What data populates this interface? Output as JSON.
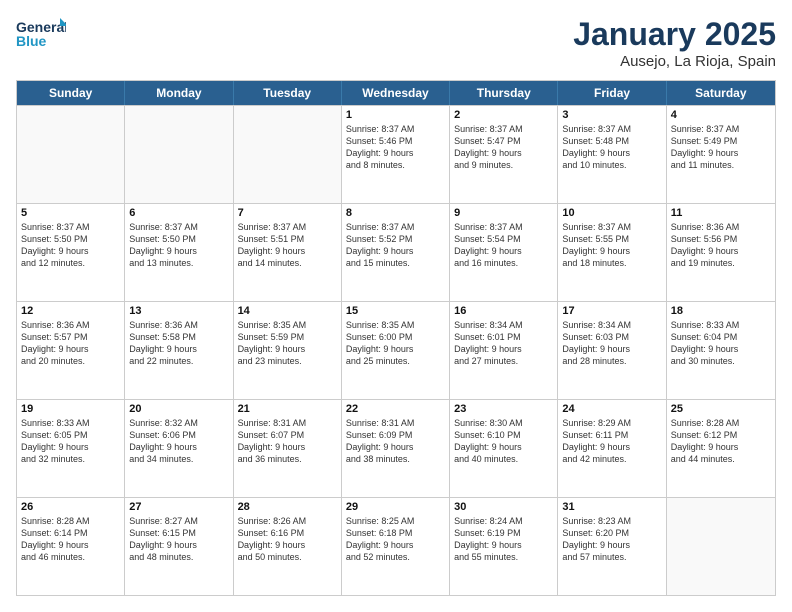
{
  "logo": {
    "line1": "General",
    "line2": "Blue"
  },
  "title": "January 2025",
  "subtitle": "Ausejo, La Rioja, Spain",
  "headers": [
    "Sunday",
    "Monday",
    "Tuesday",
    "Wednesday",
    "Thursday",
    "Friday",
    "Saturday"
  ],
  "rows": [
    [
      {
        "day": "",
        "text": ""
      },
      {
        "day": "",
        "text": ""
      },
      {
        "day": "",
        "text": ""
      },
      {
        "day": "1",
        "text": "Sunrise: 8:37 AM\nSunset: 5:46 PM\nDaylight: 9 hours\nand 8 minutes."
      },
      {
        "day": "2",
        "text": "Sunrise: 8:37 AM\nSunset: 5:47 PM\nDaylight: 9 hours\nand 9 minutes."
      },
      {
        "day": "3",
        "text": "Sunrise: 8:37 AM\nSunset: 5:48 PM\nDaylight: 9 hours\nand 10 minutes."
      },
      {
        "day": "4",
        "text": "Sunrise: 8:37 AM\nSunset: 5:49 PM\nDaylight: 9 hours\nand 11 minutes."
      }
    ],
    [
      {
        "day": "5",
        "text": "Sunrise: 8:37 AM\nSunset: 5:50 PM\nDaylight: 9 hours\nand 12 minutes."
      },
      {
        "day": "6",
        "text": "Sunrise: 8:37 AM\nSunset: 5:50 PM\nDaylight: 9 hours\nand 13 minutes."
      },
      {
        "day": "7",
        "text": "Sunrise: 8:37 AM\nSunset: 5:51 PM\nDaylight: 9 hours\nand 14 minutes."
      },
      {
        "day": "8",
        "text": "Sunrise: 8:37 AM\nSunset: 5:52 PM\nDaylight: 9 hours\nand 15 minutes."
      },
      {
        "day": "9",
        "text": "Sunrise: 8:37 AM\nSunset: 5:54 PM\nDaylight: 9 hours\nand 16 minutes."
      },
      {
        "day": "10",
        "text": "Sunrise: 8:37 AM\nSunset: 5:55 PM\nDaylight: 9 hours\nand 18 minutes."
      },
      {
        "day": "11",
        "text": "Sunrise: 8:36 AM\nSunset: 5:56 PM\nDaylight: 9 hours\nand 19 minutes."
      }
    ],
    [
      {
        "day": "12",
        "text": "Sunrise: 8:36 AM\nSunset: 5:57 PM\nDaylight: 9 hours\nand 20 minutes."
      },
      {
        "day": "13",
        "text": "Sunrise: 8:36 AM\nSunset: 5:58 PM\nDaylight: 9 hours\nand 22 minutes."
      },
      {
        "day": "14",
        "text": "Sunrise: 8:35 AM\nSunset: 5:59 PM\nDaylight: 9 hours\nand 23 minutes."
      },
      {
        "day": "15",
        "text": "Sunrise: 8:35 AM\nSunset: 6:00 PM\nDaylight: 9 hours\nand 25 minutes."
      },
      {
        "day": "16",
        "text": "Sunrise: 8:34 AM\nSunset: 6:01 PM\nDaylight: 9 hours\nand 27 minutes."
      },
      {
        "day": "17",
        "text": "Sunrise: 8:34 AM\nSunset: 6:03 PM\nDaylight: 9 hours\nand 28 minutes."
      },
      {
        "day": "18",
        "text": "Sunrise: 8:33 AM\nSunset: 6:04 PM\nDaylight: 9 hours\nand 30 minutes."
      }
    ],
    [
      {
        "day": "19",
        "text": "Sunrise: 8:33 AM\nSunset: 6:05 PM\nDaylight: 9 hours\nand 32 minutes."
      },
      {
        "day": "20",
        "text": "Sunrise: 8:32 AM\nSunset: 6:06 PM\nDaylight: 9 hours\nand 34 minutes."
      },
      {
        "day": "21",
        "text": "Sunrise: 8:31 AM\nSunset: 6:07 PM\nDaylight: 9 hours\nand 36 minutes."
      },
      {
        "day": "22",
        "text": "Sunrise: 8:31 AM\nSunset: 6:09 PM\nDaylight: 9 hours\nand 38 minutes."
      },
      {
        "day": "23",
        "text": "Sunrise: 8:30 AM\nSunset: 6:10 PM\nDaylight: 9 hours\nand 40 minutes."
      },
      {
        "day": "24",
        "text": "Sunrise: 8:29 AM\nSunset: 6:11 PM\nDaylight: 9 hours\nand 42 minutes."
      },
      {
        "day": "25",
        "text": "Sunrise: 8:28 AM\nSunset: 6:12 PM\nDaylight: 9 hours\nand 44 minutes."
      }
    ],
    [
      {
        "day": "26",
        "text": "Sunrise: 8:28 AM\nSunset: 6:14 PM\nDaylight: 9 hours\nand 46 minutes."
      },
      {
        "day": "27",
        "text": "Sunrise: 8:27 AM\nSunset: 6:15 PM\nDaylight: 9 hours\nand 48 minutes."
      },
      {
        "day": "28",
        "text": "Sunrise: 8:26 AM\nSunset: 6:16 PM\nDaylight: 9 hours\nand 50 minutes."
      },
      {
        "day": "29",
        "text": "Sunrise: 8:25 AM\nSunset: 6:18 PM\nDaylight: 9 hours\nand 52 minutes."
      },
      {
        "day": "30",
        "text": "Sunrise: 8:24 AM\nSunset: 6:19 PM\nDaylight: 9 hours\nand 55 minutes."
      },
      {
        "day": "31",
        "text": "Sunrise: 8:23 AM\nSunset: 6:20 PM\nDaylight: 9 hours\nand 57 minutes."
      },
      {
        "day": "",
        "text": ""
      }
    ]
  ]
}
